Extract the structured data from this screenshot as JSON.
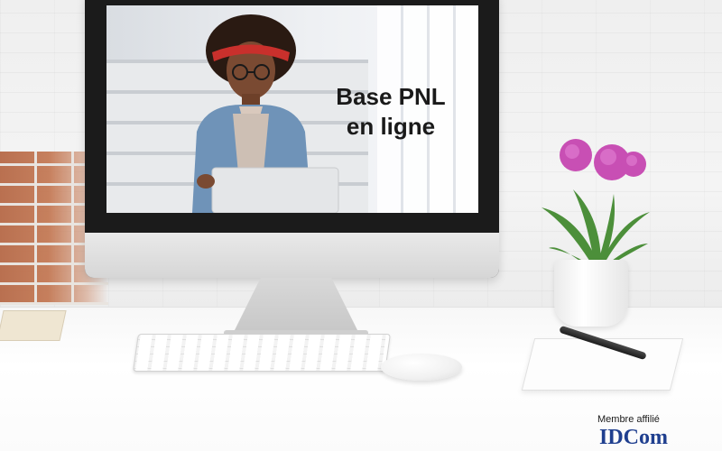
{
  "screen": {
    "title_line1": "Base PNL",
    "title_line2": "en ligne"
  },
  "badge": {
    "label": "Membre affilié",
    "logo_prefix": "ID",
    "logo_suffix": "Com",
    "logo_color": "#1f3f8f"
  },
  "colors": {
    "flower": "#c84fb4",
    "leaf": "#4c8f3a",
    "brick": "#b76a48"
  }
}
